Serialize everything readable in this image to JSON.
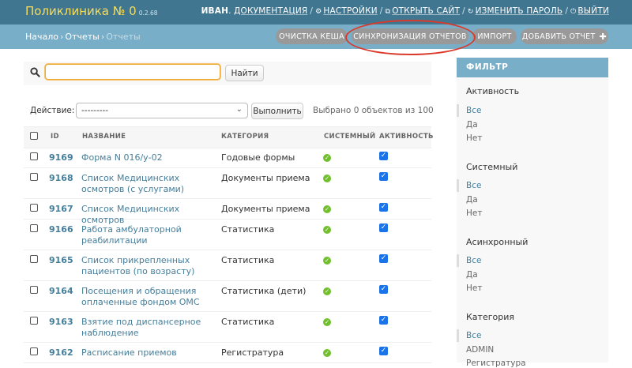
{
  "header": {
    "site_name": "Поликлиника № 0",
    "version": "0.2.68",
    "user": "ИВАН",
    "docs_link": "ДОКУМЕНТАЦИЯ",
    "settings_link": "НАСТРОЙКИ",
    "open_site_link": "ОТКРЫТЬ САЙТ",
    "change_password_link": "ИЗМЕНИТЬ ПАРОЛЬ",
    "logout_link": "ВЫЙТИ"
  },
  "breadcrumbs": [
    "Начало",
    "Отчеты",
    "Отчеты"
  ],
  "object_tools": {
    "clear_cache": "ОЧИСТКА КЕША",
    "sync_reports": "СИНХРОНИЗАЦИЯ ОТЧЕТОВ",
    "import": "ИМПОРТ",
    "add_report": "ДОБАВИТЬ ОТЧЕТ"
  },
  "search": {
    "value": "",
    "button": "Найти"
  },
  "actions": {
    "label": "Действие:",
    "selected_option": "---------",
    "go_button": "Выполнить",
    "selected_count": "Выбрано 0 объектов из 100"
  },
  "table": {
    "headers": {
      "id": "ID",
      "name": "НАЗВАНИЕ",
      "category": "КАТЕГОРИЯ",
      "system": "СИСТЕМНЫЙ",
      "active": "АКТИВНОСТЬ"
    },
    "rows": [
      {
        "id": "9169",
        "name": "Форма N 016/у-02",
        "category": "Годовые формы"
      },
      {
        "id": "9168",
        "name": "Список Медицинских осмотров (с услугами)",
        "category": "Документы приема"
      },
      {
        "id": "9167",
        "name": "Список Медицинских осмотров",
        "category": "Документы приема"
      },
      {
        "id": "9166",
        "name": "Работа амбулаторной реабилитации",
        "category": "Статистика"
      },
      {
        "id": "9165",
        "name": "Список прикрепленных пациентов (по возрасту)",
        "category": "Статистика"
      },
      {
        "id": "9164",
        "name": "Посещения и обращения оплаченные фондом ОМС",
        "category": "Статистика (дети)"
      },
      {
        "id": "9163",
        "name": "Взятие под диспансерное наблюдение",
        "category": "Статистика"
      },
      {
        "id": "9162",
        "name": "Расписание приемов",
        "category": "Регистратура"
      }
    ]
  },
  "filter": {
    "title": "ФИЛЬТР",
    "groups": [
      {
        "title": "Активность",
        "items": [
          "Все",
          "Да",
          "Нет"
        ]
      },
      {
        "title": "Системный",
        "items": [
          "Все",
          "Да",
          "Нет"
        ]
      },
      {
        "title": "Асинхронный",
        "items": [
          "Все",
          "Да",
          "Нет"
        ]
      },
      {
        "title": "Категория",
        "items": [
          "Все",
          "ADMIN",
          "Регистратура"
        ]
      }
    ]
  },
  "colors": {
    "header_bg": "#417690",
    "bar_bg": "#79aec8",
    "brand_text": "#f5dd5d",
    "link": "#447e9b",
    "annotation": "#d93a2b"
  }
}
